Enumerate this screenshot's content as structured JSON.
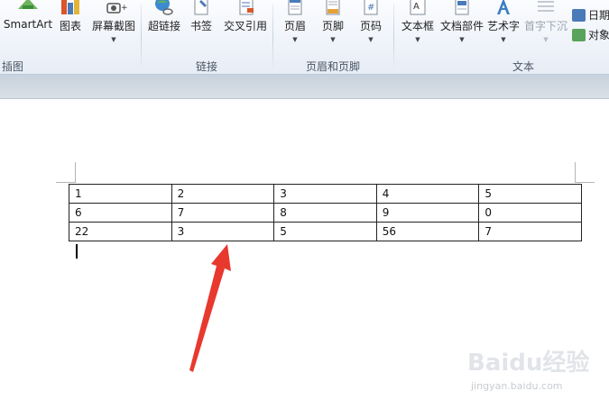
{
  "ribbon": {
    "groups": {
      "illustrations": {
        "label": "插图",
        "buttons": [
          {
            "label": "SmartArt",
            "icon": "smartart-icon"
          },
          {
            "label": "图表",
            "icon": "chart-icon"
          },
          {
            "label": "屏幕截图",
            "icon": "screenshot-icon"
          }
        ]
      },
      "links": {
        "label": "链接",
        "buttons": [
          {
            "label": "超链接",
            "icon": "hyperlink-icon"
          },
          {
            "label": "书签",
            "icon": "bookmark-icon"
          },
          {
            "label": "交叉引用",
            "icon": "cross-reference-icon"
          }
        ]
      },
      "header_footer": {
        "label": "页眉和页脚",
        "buttons": [
          {
            "label": "页眉",
            "icon": "header-icon"
          },
          {
            "label": "页脚",
            "icon": "footer-icon"
          },
          {
            "label": "页码",
            "icon": "page-number-icon"
          }
        ]
      },
      "text": {
        "label": "文本",
        "buttons": [
          {
            "label": "文本框",
            "icon": "text-box-icon"
          },
          {
            "label": "文档部件",
            "icon": "quick-parts-icon"
          },
          {
            "label": "艺术字",
            "icon": "wordart-icon"
          },
          {
            "label": "首字下沉",
            "icon": "drop-cap-icon"
          }
        ],
        "small_buttons": [
          {
            "label": "日期",
            "icon": "date-time-icon"
          },
          {
            "label": "对象",
            "icon": "object-icon"
          }
        ]
      }
    },
    "colors": {
      "accent": "#4a7ab8",
      "ribbon_bg": "#e7edf6"
    }
  },
  "document": {
    "table": {
      "rows": [
        [
          "1",
          "2",
          "3",
          "4",
          "5"
        ],
        [
          "6",
          "7",
          "8",
          "9",
          "0"
        ],
        [
          "22",
          "3",
          "5",
          "56",
          "7"
        ]
      ]
    },
    "annotation_arrow_color": "#e8392f"
  },
  "watermark": {
    "logo_text": "Baidu经验",
    "url": "jingyan.baidu.com"
  }
}
